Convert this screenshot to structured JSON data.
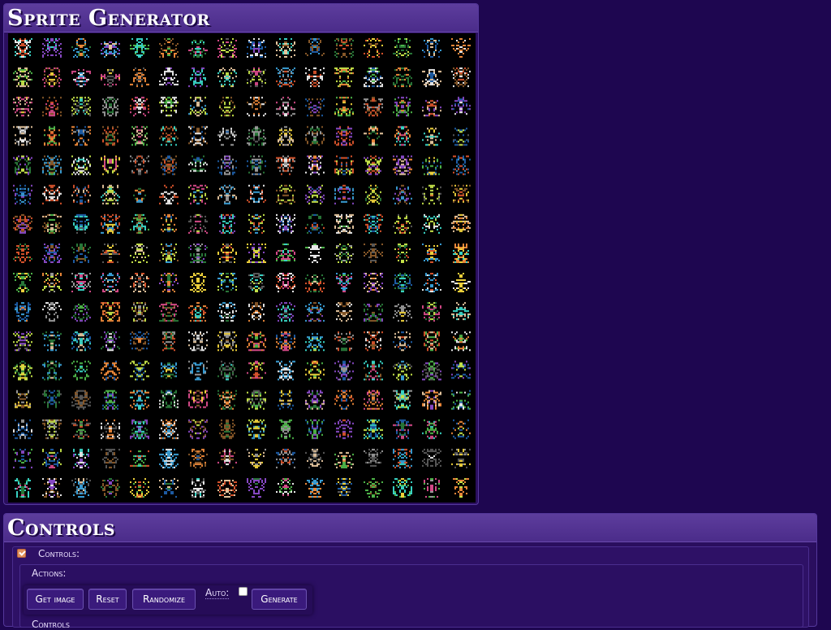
{
  "sprite_panel": {
    "title": "Sprite Generator",
    "grid": {
      "columns": 16,
      "rows": 16,
      "background": "#000000"
    },
    "palette": [
      "#d9542c",
      "#f08a3a",
      "#f3d53c",
      "#c8e64a",
      "#4fb84a",
      "#2a7a3a",
      "#3aa0d8",
      "#1e5ea8",
      "#8a4ac8",
      "#d84a8a",
      "#f0f0f0",
      "#9a9a9a",
      "#5a5a5a",
      "#e8c8a0",
      "#8a5a2a",
      "#3ad8c8"
    ]
  },
  "controls_panel": {
    "title": "Controls",
    "section_label": "Controls:",
    "actions_label": "Actions:",
    "buttons": {
      "get_image": "Get image",
      "reset": "Reset",
      "randomize": "Randomize",
      "generate": "Generate"
    },
    "auto_label": "Auto:",
    "auto_checked": false,
    "sub_section_label": "Controls"
  },
  "colors": {
    "page_bg": "#1e0650",
    "panel_bg": "#2a0e5e",
    "header_bg": "#4b2c8a",
    "accent": "#e0905a"
  }
}
